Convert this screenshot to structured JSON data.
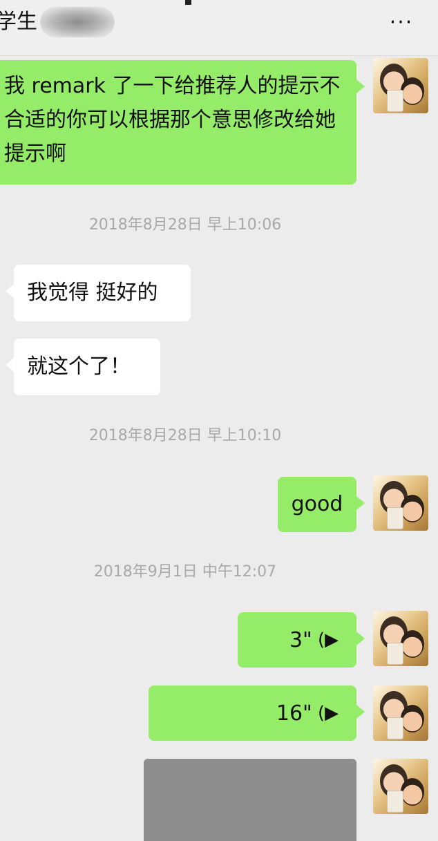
{
  "header": {
    "title": "学生",
    "more_label": "···"
  },
  "messages": [
    {
      "text": "我 remark 了一下给推荐人的提示不合适的你可以根据那个意思修改给她提示啊"
    },
    {
      "timestamp": "2018年8月28日 早上10:06"
    },
    {
      "text": "我觉得 挺好的"
    },
    {
      "text": "就这个了！"
    },
    {
      "timestamp": "2018年8月28日 早上10:10"
    },
    {
      "text": "good"
    },
    {
      "timestamp": "2018年9月1日 中午12:07"
    },
    {
      "duration": "3\""
    },
    {
      "duration": "16\""
    }
  ],
  "colors": {
    "sent_bubble": "#95ec69",
    "received_bubble": "#ffffff",
    "background": "#ececec",
    "timestamp_text": "#a8a8a8"
  },
  "icons": {
    "more": "more-dots-icon",
    "voice": "voice-wave-icon"
  }
}
